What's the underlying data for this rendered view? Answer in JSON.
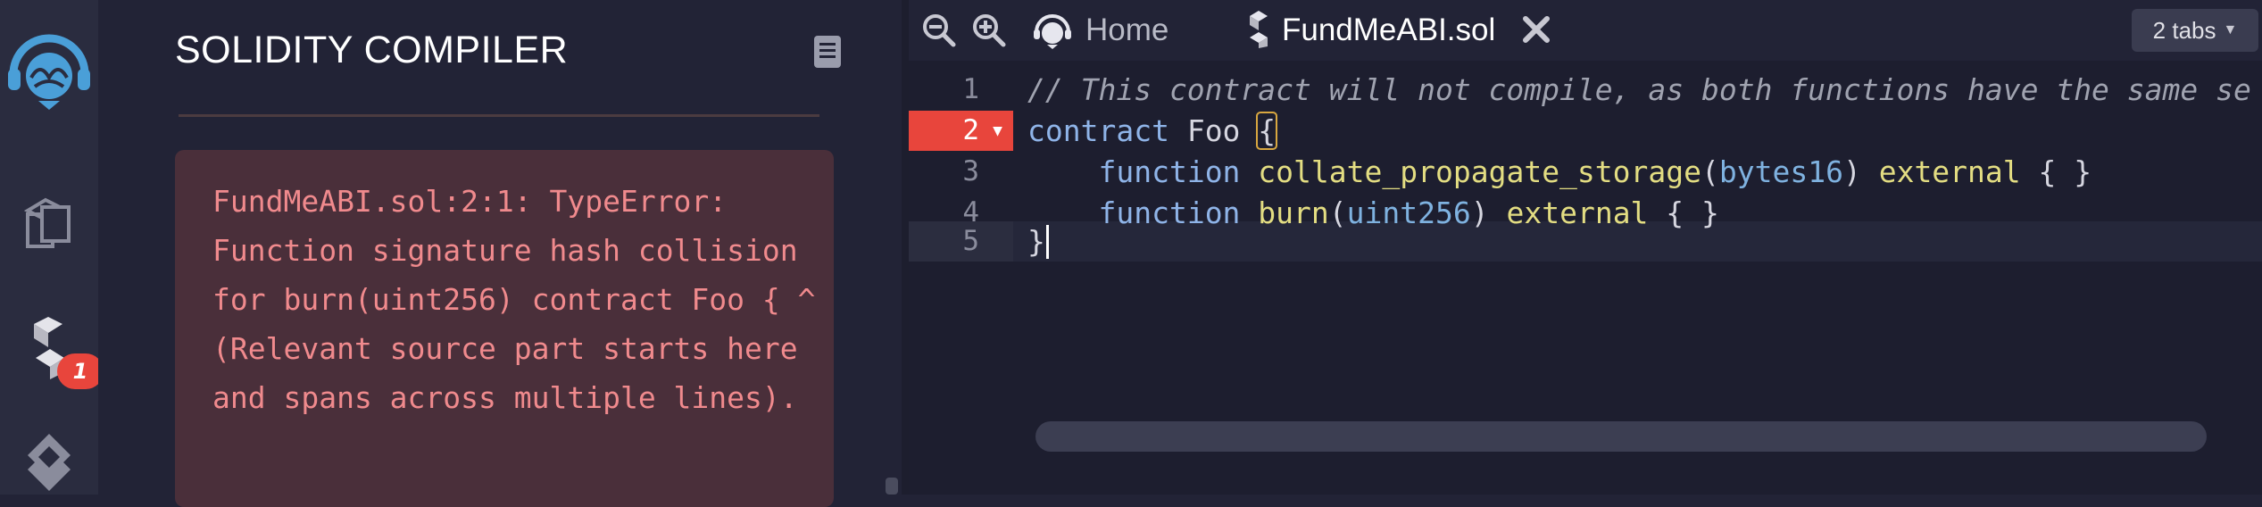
{
  "colors": {
    "rail_bg": "#2a2c3f",
    "panel_bg": "#222336",
    "editor_bg": "#1d1e2f",
    "error_box_bg": "#4a2f3a",
    "error_text": "#f08a8d",
    "error_line": "#e8453c",
    "badge": "#e8453c"
  },
  "rail": {
    "items": [
      {
        "icon": "remix-logo-icon"
      },
      {
        "icon": "file-explorer-icon"
      },
      {
        "icon": "solidity-compiler-icon",
        "badge": "1"
      },
      {
        "icon": "deploy-run-icon"
      }
    ]
  },
  "panel": {
    "title": "SOLIDITY COMPILER",
    "doc_icon": "documentation-icon",
    "error_message": "FundMeABI.sol:2:1: TypeError: Function signature hash collision for burn(uint256) contract Foo { ^ (Relevant source part starts here and spans across multiple lines)."
  },
  "editor": {
    "toolbar": {
      "zoom_out": "zoom-out-icon",
      "zoom_in": "zoom-in-icon"
    },
    "tabs": [
      {
        "label": "Home",
        "icon": "remix-home-icon"
      },
      {
        "label": "FundMeABI.sol",
        "icon": "solidity-file-icon",
        "active": true
      }
    ],
    "tabs_count": "2 tabs",
    "line_numbers": [
      "1",
      "2",
      "3",
      "4",
      "5"
    ],
    "error_line": 2,
    "code": {
      "line1": "// This contract will not compile, as both functions have the same se",
      "line2_kw": "contract",
      "line2_name": " Foo ",
      "line2_brace": "{",
      "line3_indent": "    ",
      "line3_kw": "function",
      "line3_fn": " collate_propagate_storage",
      "line3_p1": "(",
      "line3_type": "bytes16",
      "line3_p2": ") ",
      "line3_ext": "external",
      "line3_body": " { }",
      "line4_indent": "    ",
      "line4_kw": "function",
      "line4_fn": " burn",
      "line4_p1": "(",
      "line4_type": "uint256",
      "line4_p2": ") ",
      "line4_ext": "external",
      "line4_body": " { }",
      "line5": "}"
    }
  }
}
